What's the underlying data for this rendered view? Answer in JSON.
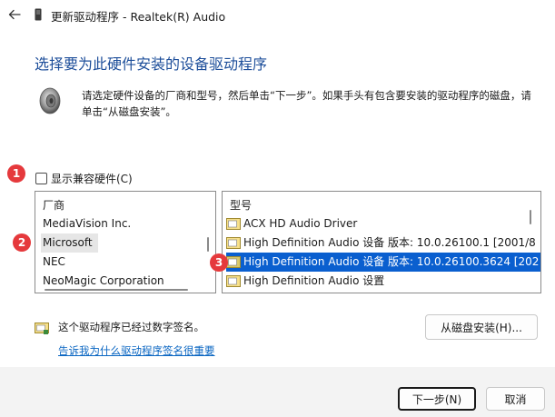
{
  "window": {
    "title": "更新驱动程序 - Realtek(R) Audio",
    "back_icon": "arrow-left-icon"
  },
  "heading": "选择要为此硬件安装的设备驱动程序",
  "instructions": "请选定硬件设备的厂商和型号，然后单击“下一步”。如果手头有包含要安装的驱动程序的磁盘，请单击“从磁盘安装”。",
  "markers": [
    "1",
    "2",
    "3"
  ],
  "show_compatible": {
    "label": "显示兼容硬件(C)",
    "checked": false
  },
  "manufacturers": {
    "header": "厂商",
    "items": [
      "MediaVision Inc.",
      "Microsoft",
      "NEC",
      "NeoMagic Corporation"
    ],
    "selected": "Microsoft"
  },
  "models": {
    "header": "型号",
    "items": [
      "ACX HD Audio Driver",
      "High Definition Audio 设备 版本: 10.0.26100.1 [2001/8",
      "High Definition Audio 设备 版本: 10.0.26100.3624 [202",
      "High Definition Audio 设置"
    ],
    "selected_index": 2
  },
  "signature_text": "这个驱动程序已经过数字签名。",
  "signature_link": "告诉我为什么驱动程序签名很重要",
  "buttons": {
    "have_disk": "从磁盘安装(H)...",
    "next": "下一步(N)",
    "cancel": "取消"
  },
  "colors": {
    "heading": "#1d4e9a",
    "selection": "#0a5fcf",
    "marker": "#e5393c",
    "link": "#0a66c2"
  }
}
